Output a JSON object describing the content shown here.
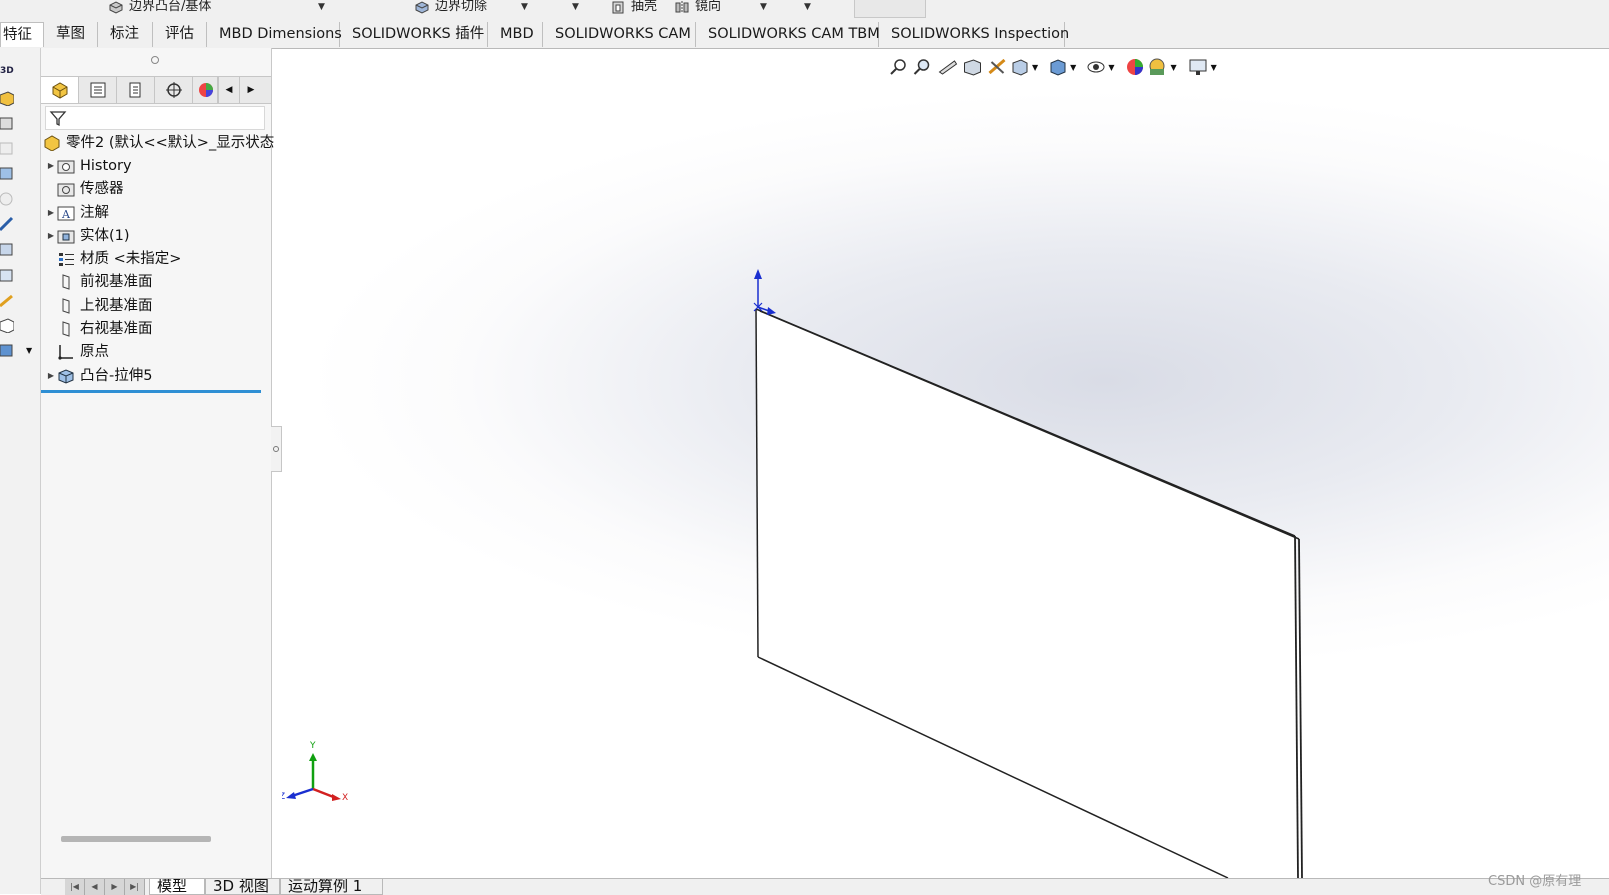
{
  "toolbar": {
    "boundary_boss": "边界凸台/基体",
    "boundary_cut": "边界切除",
    "shell": "抽壳",
    "mirror": "镜向"
  },
  "tabs": [
    {
      "label": "特征",
      "active": true
    },
    {
      "label": "草图"
    },
    {
      "label": "标注"
    },
    {
      "label": "评估"
    },
    {
      "label": "MBD Dimensions"
    },
    {
      "label": "SOLIDWORKS 插件"
    },
    {
      "label": "MBD"
    },
    {
      "label": "SOLIDWORKS CAM"
    },
    {
      "label": "SOLIDWORKS CAM TBM"
    },
    {
      "label": "SOLIDWORKS Inspection"
    }
  ],
  "tree": {
    "root": "零件2 (默认<<默认>_显示状态",
    "items": [
      {
        "label": "History",
        "expandable": true,
        "icon": "history-folder-icon"
      },
      {
        "label": "传感器",
        "expandable": false,
        "icon": "sensor-folder-icon"
      },
      {
        "label": "注解",
        "expandable": true,
        "icon": "annotation-folder-icon"
      },
      {
        "label": "实体(1)",
        "expandable": true,
        "icon": "solid-bodies-folder-icon"
      },
      {
        "label": "材质 <未指定>",
        "expandable": false,
        "icon": "material-icon"
      },
      {
        "label": "前视基准面",
        "expandable": false,
        "icon": "plane-icon"
      },
      {
        "label": "上视基准面",
        "expandable": false,
        "icon": "plane-icon"
      },
      {
        "label": "右视基准面",
        "expandable": false,
        "icon": "plane-icon"
      },
      {
        "label": "原点",
        "expandable": false,
        "icon": "origin-icon"
      },
      {
        "label": "凸台-拉伸5",
        "expandable": true,
        "icon": "extrude-icon"
      }
    ]
  },
  "bottom_tabs": [
    {
      "label": "模型",
      "active": true
    },
    {
      "label": "3D 视图"
    },
    {
      "label": "运动算例 1"
    }
  ],
  "triad": {
    "x": "X",
    "y": "Y",
    "z": "Z"
  },
  "left_strip_label": "3D",
  "watermark": "CSDN @原有理",
  "colors": {
    "selection": "#2f8fd4",
    "axis_x": "#d22020",
    "axis_y": "#10a010",
    "axis_z": "#1a2fd0"
  }
}
